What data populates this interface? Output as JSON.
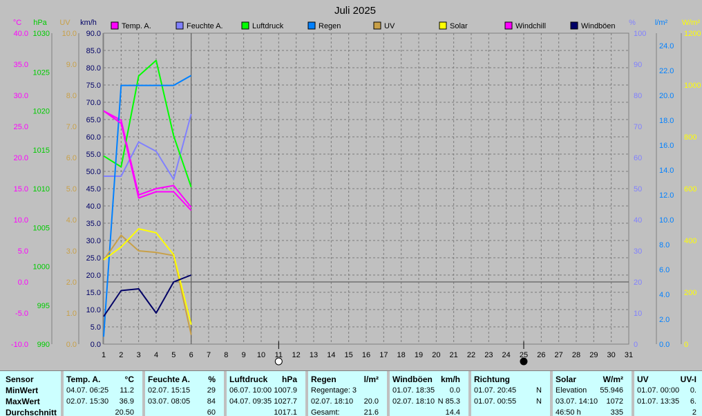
{
  "chart_data": {
    "type": "line",
    "title": "Juli 2025",
    "x": [
      1,
      2,
      3,
      4,
      5,
      6
    ],
    "x_ticks": [
      1,
      2,
      3,
      4,
      5,
      6,
      7,
      8,
      9,
      10,
      11,
      12,
      13,
      14,
      15,
      16,
      17,
      18,
      19,
      20,
      21,
      22,
      23,
      24,
      25,
      26,
      27,
      28,
      29,
      30,
      31
    ],
    "xlim": [
      1,
      31
    ],
    "grid": true,
    "moon_markers": [
      {
        "day": 11,
        "phase": "full"
      },
      {
        "day": 25,
        "phase": "new"
      }
    ],
    "axes": [
      {
        "id": "temp",
        "unit": "°C",
        "color": "#ff00ff",
        "ylim": [
          -10,
          40
        ],
        "ticks": [
          "-10.0",
          "-5.0",
          "0.0",
          "5.0",
          "10.0",
          "15.0",
          "20.0",
          "25.0",
          "30.0",
          "35.0",
          "40.0"
        ]
      },
      {
        "id": "press",
        "unit": "hPa",
        "color": "#00cc00",
        "ylim": [
          990,
          1030
        ],
        "ticks": [
          "990",
          "995",
          "1000",
          "1005",
          "1010",
          "1015",
          "1020",
          "1025",
          "1030"
        ]
      },
      {
        "id": "uv",
        "unit": "UV",
        "color": "#c8a048",
        "ylim": [
          0,
          10
        ],
        "ticks": [
          "0.0",
          "1.0",
          "2.0",
          "3.0",
          "4.0",
          "5.0",
          "6.0",
          "7.0",
          "8.0",
          "9.0",
          "10.0"
        ]
      },
      {
        "id": "wind",
        "unit": "km/h",
        "color": "#000066",
        "ylim": [
          0,
          90
        ],
        "ticks": [
          "0.0",
          "5.0",
          "10.0",
          "15.0",
          "20.0",
          "25.0",
          "30.0",
          "35.0",
          "40.0",
          "45.0",
          "50.0",
          "55.0",
          "60.0",
          "65.0",
          "70.0",
          "75.0",
          "80.0",
          "85.0",
          "90.0"
        ]
      },
      {
        "id": "hum",
        "unit": "%",
        "color": "#8080ff",
        "ylim": [
          0,
          100
        ],
        "ticks": [
          "0",
          "10",
          "20",
          "30",
          "40",
          "50",
          "60",
          "70",
          "80",
          "90",
          "100"
        ]
      },
      {
        "id": "rain",
        "unit": "l/m²",
        "color": "#0080ff",
        "ylim": [
          0,
          25
        ],
        "ticks": [
          "0.0",
          "2.0",
          "4.0",
          "6.0",
          "8.0",
          "10.0",
          "12.0",
          "14.0",
          "16.0",
          "18.0",
          "20.0",
          "22.0",
          "24.0"
        ]
      },
      {
        "id": "solar",
        "unit": "W/m²",
        "color": "#ffff00",
        "ylim": [
          0,
          1200
        ],
        "ticks": [
          "0",
          "200",
          "400",
          "600",
          "800",
          "1000",
          "1200"
        ]
      }
    ],
    "series": [
      {
        "name": "Temp. A.",
        "color": "#ff00ff",
        "axis": "temp",
        "values": [
          27.5,
          26.0,
          14.0,
          15.0,
          15.5,
          12.0
        ]
      },
      {
        "name": "Feuchte A.",
        "color": "#8080ff",
        "axis": "hum",
        "values": [
          54,
          54,
          65,
          62,
          53,
          74
        ]
      },
      {
        "name": "Luftdruck",
        "color": "#00ff00",
        "axis": "press",
        "values": [
          1014.2,
          1012.8,
          1024.5,
          1026.5,
          1016.8,
          1010.2
        ]
      },
      {
        "name": "Regen",
        "color": "#0080ff",
        "axis": "rain",
        "values": [
          0.6,
          20.8,
          20.8,
          20.8,
          20.8,
          21.6
        ]
      },
      {
        "name": "UV",
        "color": "#c8a048",
        "axis": "uv",
        "values": [
          2.7,
          3.5,
          3.0,
          2.95,
          2.85,
          0.3
        ]
      },
      {
        "name": "Solar",
        "color": "#ffff00",
        "axis": "solar",
        "values": [
          325,
          375,
          445,
          430,
          345,
          75
        ]
      },
      {
        "name": "Windchill",
        "color": "#ff00ff",
        "axis": "temp",
        "values": [
          27.5,
          25.5,
          13.5,
          14.5,
          14.5,
          11.5
        ]
      },
      {
        "name": "Windböen",
        "color": "#000066",
        "axis": "wind",
        "values": [
          8.0,
          15.5,
          16.0,
          9.0,
          18.0,
          20.0
        ]
      }
    ]
  },
  "table": [
    {
      "title": "Sensor",
      "unit": "",
      "rows": [
        [
          "MinWert",
          ""
        ],
        [
          "MaxWert",
          ""
        ],
        [
          "Durchschnitt",
          ""
        ]
      ]
    },
    {
      "title": "Temp. A.",
      "unit": "°C",
      "rows": [
        [
          "04.07.  06:25",
          "11.2"
        ],
        [
          "02.07.  15:30",
          "36.9"
        ],
        [
          "",
          "20.50"
        ]
      ]
    },
    {
      "title": "Feuchte A.",
      "unit": "%",
      "rows": [
        [
          "02.07.  15:15",
          "29"
        ],
        [
          "03.07.  08:05",
          "84"
        ],
        [
          "",
          "60"
        ]
      ]
    },
    {
      "title": "Luftdruck",
      "unit": "hPa",
      "rows": [
        [
          "06.07.  10:00",
          "1007.9"
        ],
        [
          "04.07.  09:35",
          "1027.7"
        ],
        [
          "",
          "1017.1"
        ]
      ]
    },
    {
      "title": "Regen",
      "unit": "l/m²",
      "rows": [
        [
          "Regentage: 3",
          ""
        ],
        [
          "02.07.  18:10",
          "20.0"
        ],
        [
          "Gesamt:",
          "21.6"
        ]
      ]
    },
    {
      "title": "Windböen",
      "unit": "km/h",
      "rows": [
        [
          "01.07.  18:35",
          "0.0"
        ],
        [
          "02.07.  18:10",
          "N 85.3"
        ],
        [
          "",
          "14.4"
        ]
      ]
    },
    {
      "title": "Richtung",
      "unit": "",
      "rows": [
        [
          "01.07.  20:45",
          "N"
        ],
        [
          "01.07.  00:55",
          "N"
        ],
        [
          "",
          ""
        ]
      ]
    },
    {
      "title": "Solar",
      "unit": "W/m²",
      "rows": [
        [
          "Elevation",
          "55.946"
        ],
        [
          "03.07.  14:10",
          "1072"
        ],
        [
          "46:50 h",
          "335"
        ]
      ]
    },
    {
      "title": "UV",
      "unit": "UV-I",
      "rows": [
        [
          "01.07.  00:00",
          "0."
        ],
        [
          "01.07.  13:35",
          "6."
        ],
        [
          "",
          "2"
        ]
      ]
    }
  ]
}
